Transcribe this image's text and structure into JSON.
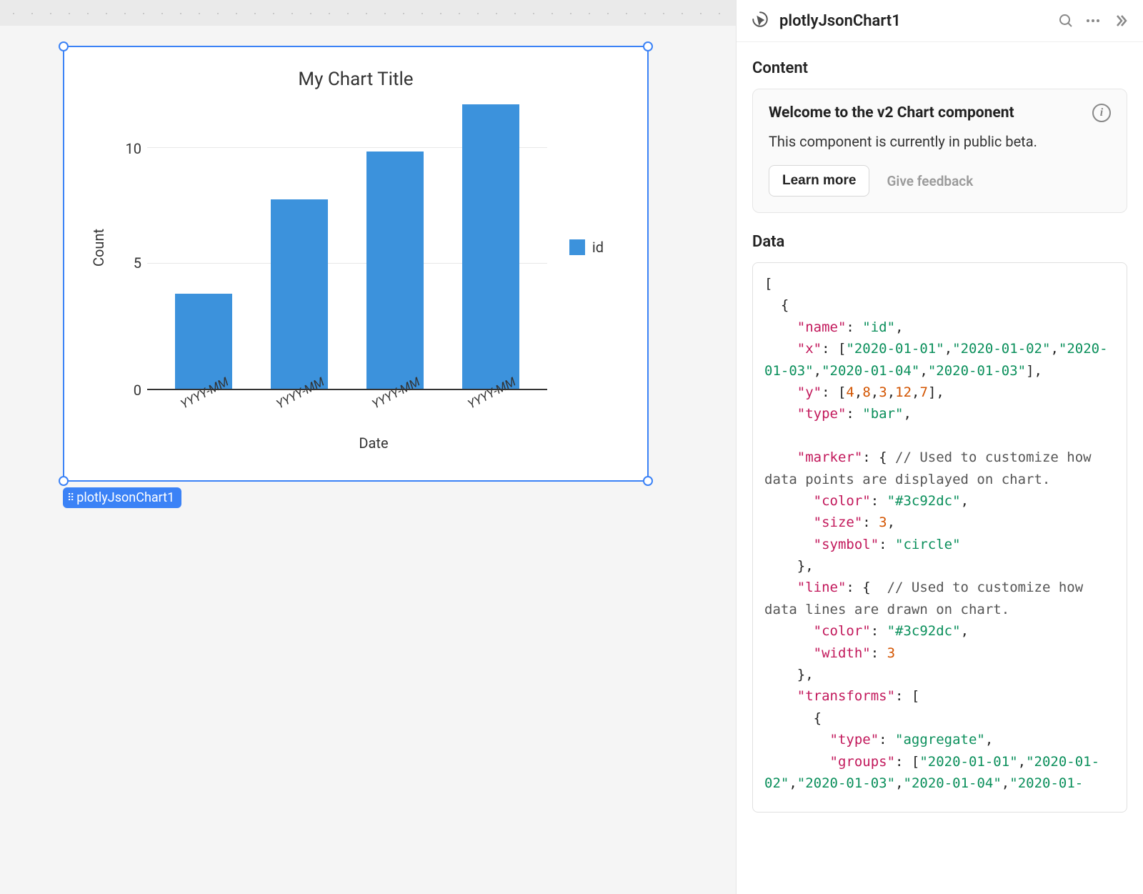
{
  "canvas": {
    "component_tag": "plotlyJsonChart1"
  },
  "chart": {
    "title": "My Chart Title",
    "xlabel": "Date",
    "ylabel": "Count",
    "legend_label": "id",
    "yticks": [
      "10",
      "5",
      "0"
    ],
    "xticks": [
      "YYYY-MM",
      "YYYY-MM",
      "YYYY-MM",
      "YYYY-MM"
    ]
  },
  "chart_data": {
    "type": "bar",
    "title": "My Chart Title",
    "xlabel": "Date",
    "ylabel": "Count",
    "ylim": [
      0,
      12
    ],
    "yticks": [
      0,
      5,
      10
    ],
    "categories": [
      "YYYY-MM",
      "YYYY-MM",
      "YYYY-MM",
      "YYYY-MM"
    ],
    "series": [
      {
        "name": "id",
        "values": [
          4,
          8,
          10,
          12
        ],
        "color": "#3c92dc"
      }
    ]
  },
  "panel": {
    "title": "plotlyJsonChart1",
    "section_content": "Content",
    "notice": {
      "title": "Welcome to the v2 Chart component",
      "body": "This component is currently in public beta.",
      "learn_more": "Learn more",
      "give_feedback": "Give feedback"
    },
    "section_data": "Data"
  },
  "code": {
    "l01": "[",
    "l02": "  {",
    "l03a": "    ",
    "k_name": "\"name\"",
    "p1": ": ",
    "v_name": "\"id\"",
    "c1": ",",
    "l04a": "    ",
    "k_x": "\"x\"",
    "p2": ": [",
    "v_x1": "\"2020-01-01\"",
    "c2": ",",
    "v_x2": "\"2020-01-02\"",
    "c3": ",",
    "v_x3": "\"2020-01-03\"",
    "c4": ",",
    "v_x4": "\"2020-01-04\"",
    "c5": ",",
    "v_x5": "\"2020-01-03\"",
    "p3": "],",
    "l05a": "    ",
    "k_y": "\"y\"",
    "p4": ": [",
    "v_y1": "4",
    "c6": ",",
    "v_y2": "8",
    "c7": ",",
    "v_y3": "3",
    "c8": ",",
    "v_y4": "12",
    "c9": ",",
    "v_y5": "7",
    "p5": "],",
    "l06a": "    ",
    "k_type": "\"type\"",
    "p6": ": ",
    "v_type": "\"bar\"",
    "c10": ",",
    "blank": "",
    "l07a": "    ",
    "k_marker": "\"marker\"",
    "p7": ": { ",
    "cmt_marker": "// Used to customize how data points are displayed on chart.",
    "l08a": "      ",
    "k_color": "\"color\"",
    "p8": ": ",
    "v_color": "\"#3c92dc\"",
    "c11": ",",
    "l09a": "      ",
    "k_size": "\"size\"",
    "p9": ": ",
    "v_size": "3",
    "c12": ",",
    "l10a": "      ",
    "k_symbol": "\"symbol\"",
    "p10": ": ",
    "v_symbol": "\"circle\"",
    "l11": "    },",
    "l12a": "    ",
    "k_line": "\"line\"",
    "p12": ": {  ",
    "cmt_line": "// Used to customize how data lines are drawn on chart.",
    "l13a": "      ",
    "k_lcolor": "\"color\"",
    "p13": ": ",
    "v_lcolor": "\"#3c92dc\"",
    "c13": ",",
    "l14a": "      ",
    "k_width": "\"width\"",
    "p14": ": ",
    "v_width": "3",
    "l15": "    },",
    "l16a": "    ",
    "k_transforms": "\"transforms\"",
    "p16": ": [",
    "l17": "      {",
    "l18a": "        ",
    "k_ttype": "\"type\"",
    "p18": ": ",
    "v_ttype": "\"aggregate\"",
    "c18": ",",
    "l19a": "        ",
    "k_groups": "\"groups\"",
    "p19": ": [",
    "v_g1": "\"2020-01-01\"",
    "c19a": ",",
    "v_g2": "\"2020-01-02\"",
    "c19b": ",",
    "v_g3": "\"2020-01-03\"",
    "c19c": ",",
    "v_g4": "\"2020-01-04\"",
    "c19d": ",",
    "v_g5": "\"2020-01-"
  }
}
